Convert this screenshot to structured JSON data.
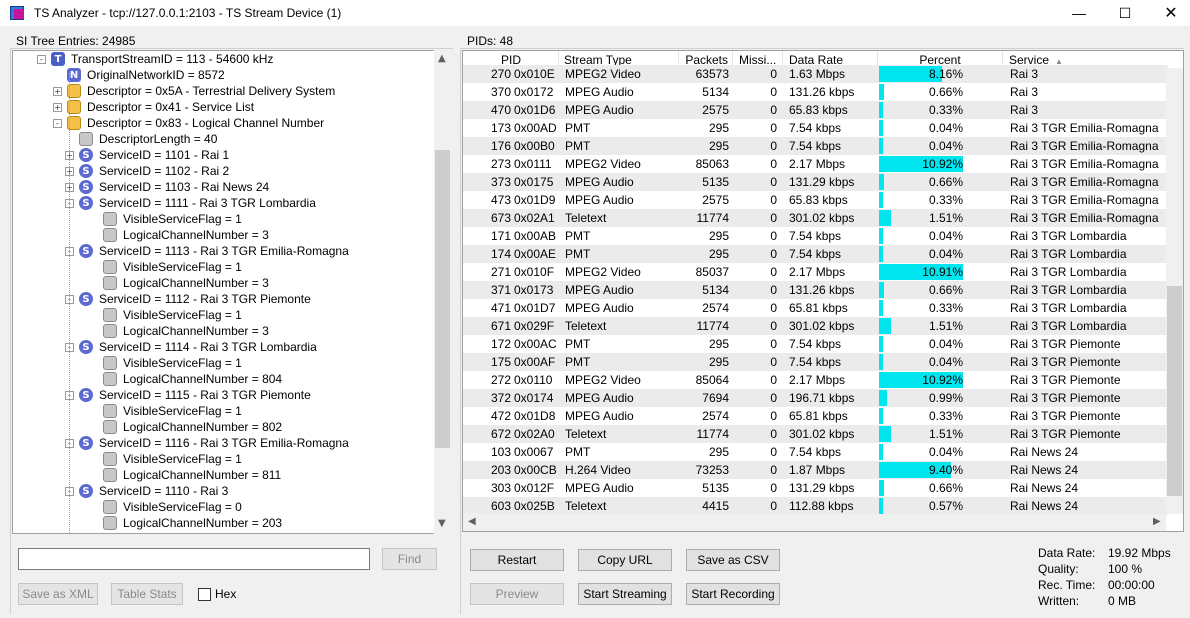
{
  "window": {
    "title": "TS Analyzer - tcp://127.0.0.1:2103 - TS Stream Device (1)",
    "min_glyph": "—",
    "max_glyph": "☐",
    "close_glyph": "✕"
  },
  "left_panel": {
    "header": "SI Tree Entries: 24985",
    "tree": [
      {
        "label": "TransportStreamID = 113 - 54600 kHz",
        "icon": "T",
        "exp": "-",
        "indent": 0
      },
      {
        "label": "OriginalNetworkID = 8572",
        "icon": "N",
        "exp": "",
        "indent": 1
      },
      {
        "label": "Descriptor = 0x5A - Terrestrial Delivery System",
        "icon": "D",
        "exp": "+",
        "indent": 1
      },
      {
        "label": "Descriptor = 0x41 - Service List",
        "icon": "D",
        "exp": "+",
        "indent": 1
      },
      {
        "label": "Descriptor = 0x83 - Logical Channel Number",
        "icon": "D",
        "exp": "-",
        "indent": 1
      },
      {
        "label": "DescriptorLength = 40",
        "icon": "F",
        "exp": "",
        "indent": 2
      },
      {
        "label": "ServiceID = 1101 - Rai 1",
        "icon": "S",
        "exp": "+",
        "indent": 2
      },
      {
        "label": "ServiceID = 1102 - Rai 2",
        "icon": "S",
        "exp": "+",
        "indent": 2
      },
      {
        "label": "ServiceID = 1103 - Rai News 24",
        "icon": "S",
        "exp": "+",
        "indent": 2
      },
      {
        "label": "ServiceID = 1111 - Rai 3 TGR Lombardia",
        "icon": "S",
        "exp": "-",
        "indent": 2
      },
      {
        "label": "VisibleServiceFlag = 1",
        "icon": "F",
        "exp": "",
        "indent": 3
      },
      {
        "label": "LogicalChannelNumber = 3",
        "icon": "F",
        "exp": "",
        "indent": 3
      },
      {
        "label": "ServiceID = 1113 - Rai 3 TGR Emilia-Romagna",
        "icon": "S",
        "exp": "-",
        "indent": 2
      },
      {
        "label": "VisibleServiceFlag = 1",
        "icon": "F",
        "exp": "",
        "indent": 3
      },
      {
        "label": "LogicalChannelNumber = 3",
        "icon": "F",
        "exp": "",
        "indent": 3
      },
      {
        "label": "ServiceID = 1112 - Rai 3 TGR Piemonte",
        "icon": "S",
        "exp": "-",
        "indent": 2
      },
      {
        "label": "VisibleServiceFlag = 1",
        "icon": "F",
        "exp": "",
        "indent": 3
      },
      {
        "label": "LogicalChannelNumber = 3",
        "icon": "F",
        "exp": "",
        "indent": 3
      },
      {
        "label": "ServiceID = 1114 - Rai 3 TGR Lombardia",
        "icon": "S",
        "exp": "-",
        "indent": 2
      },
      {
        "label": "VisibleServiceFlag = 1",
        "icon": "F",
        "exp": "",
        "indent": 3
      },
      {
        "label": "LogicalChannelNumber = 804",
        "icon": "F",
        "exp": "",
        "indent": 3
      },
      {
        "label": "ServiceID = 1115 - Rai 3 TGR Piemonte",
        "icon": "S",
        "exp": "-",
        "indent": 2
      },
      {
        "label": "VisibleServiceFlag = 1",
        "icon": "F",
        "exp": "",
        "indent": 3
      },
      {
        "label": "LogicalChannelNumber = 802",
        "icon": "F",
        "exp": "",
        "indent": 3
      },
      {
        "label": "ServiceID = 1116 - Rai 3 TGR Emilia-Romagna",
        "icon": "S",
        "exp": "-",
        "indent": 2
      },
      {
        "label": "VisibleServiceFlag = 1",
        "icon": "F",
        "exp": "",
        "indent": 3
      },
      {
        "label": "LogicalChannelNumber = 811",
        "icon": "F",
        "exp": "",
        "indent": 3
      },
      {
        "label": "ServiceID = 1110 - Rai 3",
        "icon": "S",
        "exp": "-",
        "indent": 2
      },
      {
        "label": "VisibleServiceFlag = 0",
        "icon": "F",
        "exp": "",
        "indent": 3
      },
      {
        "label": "LogicalChannelNumber = 203",
        "icon": "F",
        "exp": "",
        "indent": 3
      }
    ],
    "find_value": "",
    "find_label": "Find",
    "save_xml_label": "Save as XML",
    "table_stats_label": "Table Stats",
    "hex_label": "Hex",
    "hex_checked": false
  },
  "right_panel": {
    "header": "PIDs: 48",
    "columns": [
      "PID",
      "Stream Type",
      "Packets",
      "Missi...",
      "Data Rate",
      "Percent",
      "Service"
    ],
    "sorted_column": "Service",
    "rows": [
      {
        "pid": "270",
        "hex": "0x010E",
        "type": "MPEG2 Video",
        "packets": "63573",
        "missing": "0",
        "rate": "1.63 Mbps",
        "percent": "8.16%",
        "pct": 8.16,
        "service": "Rai 3"
      },
      {
        "pid": "370",
        "hex": "0x0172",
        "type": "MPEG Audio",
        "packets": "5134",
        "missing": "0",
        "rate": "131.26 kbps",
        "percent": "0.66%",
        "pct": 0.66,
        "service": "Rai 3"
      },
      {
        "pid": "470",
        "hex": "0x01D6",
        "type": "MPEG Audio",
        "packets": "2575",
        "missing": "0",
        "rate": "65.83 kbps",
        "percent": "0.33%",
        "pct": 0.33,
        "service": "Rai 3"
      },
      {
        "pid": "173",
        "hex": "0x00AD",
        "type": "PMT",
        "packets": "295",
        "missing": "0",
        "rate": "7.54 kbps",
        "percent": "0.04%",
        "pct": 0.04,
        "service": "Rai 3 TGR Emilia-Romagna"
      },
      {
        "pid": "176",
        "hex": "0x00B0",
        "type": "PMT",
        "packets": "295",
        "missing": "0",
        "rate": "7.54 kbps",
        "percent": "0.04%",
        "pct": 0.04,
        "service": "Rai 3 TGR Emilia-Romagna"
      },
      {
        "pid": "273",
        "hex": "0x0111",
        "type": "MPEG2 Video",
        "packets": "85063",
        "missing": "0",
        "rate": "2.17 Mbps",
        "percent": "10.92%",
        "pct": 10.92,
        "service": "Rai 3 TGR Emilia-Romagna"
      },
      {
        "pid": "373",
        "hex": "0x0175",
        "type": "MPEG Audio",
        "packets": "5135",
        "missing": "0",
        "rate": "131.29 kbps",
        "percent": "0.66%",
        "pct": 0.66,
        "service": "Rai 3 TGR Emilia-Romagna"
      },
      {
        "pid": "473",
        "hex": "0x01D9",
        "type": "MPEG Audio",
        "packets": "2575",
        "missing": "0",
        "rate": "65.83 kbps",
        "percent": "0.33%",
        "pct": 0.33,
        "service": "Rai 3 TGR Emilia-Romagna"
      },
      {
        "pid": "673",
        "hex": "0x02A1",
        "type": "Teletext",
        "packets": "11774",
        "missing": "0",
        "rate": "301.02 kbps",
        "percent": "1.51%",
        "pct": 1.51,
        "service": "Rai 3 TGR Emilia-Romagna"
      },
      {
        "pid": "171",
        "hex": "0x00AB",
        "type": "PMT",
        "packets": "295",
        "missing": "0",
        "rate": "7.54 kbps",
        "percent": "0.04%",
        "pct": 0.04,
        "service": "Rai 3 TGR Lombardia"
      },
      {
        "pid": "174",
        "hex": "0x00AE",
        "type": "PMT",
        "packets": "295",
        "missing": "0",
        "rate": "7.54 kbps",
        "percent": "0.04%",
        "pct": 0.04,
        "service": "Rai 3 TGR Lombardia"
      },
      {
        "pid": "271",
        "hex": "0x010F",
        "type": "MPEG2 Video",
        "packets": "85037",
        "missing": "0",
        "rate": "2.17 Mbps",
        "percent": "10.91%",
        "pct": 10.91,
        "service": "Rai 3 TGR Lombardia"
      },
      {
        "pid": "371",
        "hex": "0x0173",
        "type": "MPEG Audio",
        "packets": "5134",
        "missing": "0",
        "rate": "131.26 kbps",
        "percent": "0.66%",
        "pct": 0.66,
        "service": "Rai 3 TGR Lombardia"
      },
      {
        "pid": "471",
        "hex": "0x01D7",
        "type": "MPEG Audio",
        "packets": "2574",
        "missing": "0",
        "rate": "65.81 kbps",
        "percent": "0.33%",
        "pct": 0.33,
        "service": "Rai 3 TGR Lombardia"
      },
      {
        "pid": "671",
        "hex": "0x029F",
        "type": "Teletext",
        "packets": "11774",
        "missing": "0",
        "rate": "301.02 kbps",
        "percent": "1.51%",
        "pct": 1.51,
        "service": "Rai 3 TGR Lombardia"
      },
      {
        "pid": "172",
        "hex": "0x00AC",
        "type": "PMT",
        "packets": "295",
        "missing": "0",
        "rate": "7.54 kbps",
        "percent": "0.04%",
        "pct": 0.04,
        "service": "Rai 3 TGR Piemonte"
      },
      {
        "pid": "175",
        "hex": "0x00AF",
        "type": "PMT",
        "packets": "295",
        "missing": "0",
        "rate": "7.54 kbps",
        "percent": "0.04%",
        "pct": 0.04,
        "service": "Rai 3 TGR Piemonte"
      },
      {
        "pid": "272",
        "hex": "0x0110",
        "type": "MPEG2 Video",
        "packets": "85064",
        "missing": "0",
        "rate": "2.17 Mbps",
        "percent": "10.92%",
        "pct": 10.92,
        "service": "Rai 3 TGR Piemonte"
      },
      {
        "pid": "372",
        "hex": "0x0174",
        "type": "MPEG Audio",
        "packets": "7694",
        "missing": "0",
        "rate": "196.71 kbps",
        "percent": "0.99%",
        "pct": 0.99,
        "service": "Rai 3 TGR Piemonte"
      },
      {
        "pid": "472",
        "hex": "0x01D8",
        "type": "MPEG Audio",
        "packets": "2574",
        "missing": "0",
        "rate": "65.81 kbps",
        "percent": "0.33%",
        "pct": 0.33,
        "service": "Rai 3 TGR Piemonte"
      },
      {
        "pid": "672",
        "hex": "0x02A0",
        "type": "Teletext",
        "packets": "11774",
        "missing": "0",
        "rate": "301.02 kbps",
        "percent": "1.51%",
        "pct": 1.51,
        "service": "Rai 3 TGR Piemonte"
      },
      {
        "pid": "103",
        "hex": "0x0067",
        "type": "PMT",
        "packets": "295",
        "missing": "0",
        "rate": "7.54 kbps",
        "percent": "0.04%",
        "pct": 0.04,
        "service": "Rai News 24"
      },
      {
        "pid": "203",
        "hex": "0x00CB",
        "type": "H.264 Video",
        "packets": "73253",
        "missing": "0",
        "rate": "1.87 Mbps",
        "percent": "9.40%",
        "pct": 9.4,
        "service": "Rai News 24"
      },
      {
        "pid": "303",
        "hex": "0x012F",
        "type": "MPEG Audio",
        "packets": "5135",
        "missing": "0",
        "rate": "131.29 kbps",
        "percent": "0.66%",
        "pct": 0.66,
        "service": "Rai News 24"
      },
      {
        "pid": "603",
        "hex": "0x025B",
        "type": "Teletext",
        "packets": "4415",
        "missing": "0",
        "rate": "112.88 kbps",
        "percent": "0.57%",
        "pct": 0.57,
        "service": "Rai News 24"
      }
    ],
    "buttons": {
      "restart": "Restart",
      "copy_url": "Copy URL",
      "save_csv": "Save as CSV",
      "preview": "Preview",
      "start_streaming": "Start Streaming",
      "start_recording": "Start Recording"
    },
    "stats": {
      "data_rate_label": "Data Rate:",
      "data_rate_value": "19.92 Mbps",
      "quality_label": "Quality:",
      "quality_value": "100 %",
      "rec_time_label": "Rec. Time:",
      "rec_time_value": "00:00:00",
      "written_label": "Written:",
      "written_value": "0 MB"
    },
    "bar_color": "#00e5ee"
  }
}
